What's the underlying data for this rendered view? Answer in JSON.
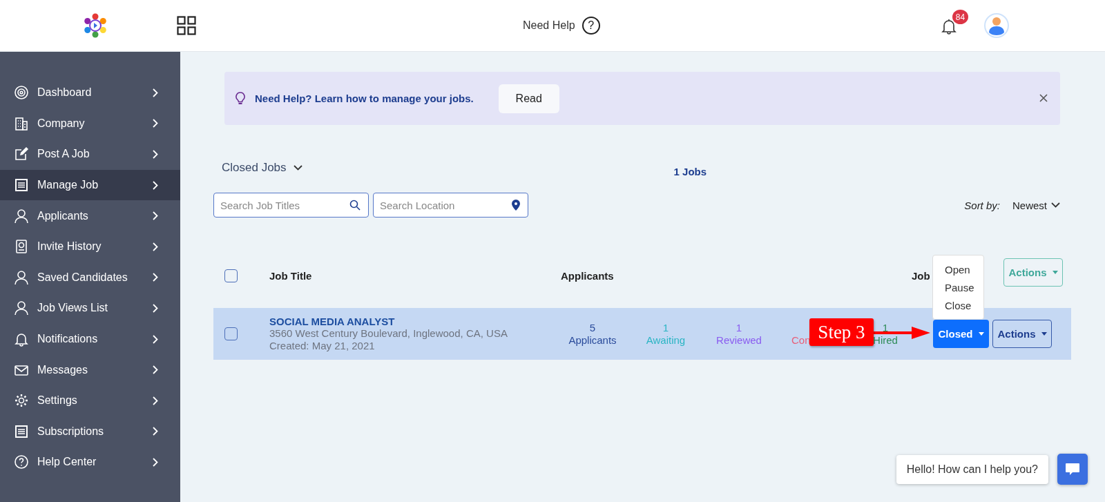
{
  "header": {
    "help_label": "Need Help",
    "help_glyph": "?",
    "notification_count": "84"
  },
  "sidebar": {
    "items": [
      {
        "label": "Dashboard",
        "kind": "target",
        "selected": false
      },
      {
        "label": "Company",
        "kind": "building",
        "selected": false
      },
      {
        "label": "Post A Job",
        "kind": "edit",
        "selected": false
      },
      {
        "label": "Manage Job",
        "kind": "list",
        "selected": true
      },
      {
        "label": "Applicants",
        "kind": "user",
        "selected": false
      },
      {
        "label": "Invite History",
        "kind": "invite",
        "selected": false
      },
      {
        "label": "Saved Candidates",
        "kind": "user",
        "selected": false
      },
      {
        "label": "Job Views List",
        "kind": "user",
        "selected": false
      },
      {
        "label": "Notifications",
        "kind": "bell",
        "selected": false
      },
      {
        "label": "Messages",
        "kind": "mail",
        "selected": false
      },
      {
        "label": "Settings",
        "kind": "gear",
        "selected": false
      },
      {
        "label": "Subscriptions",
        "kind": "list",
        "selected": false
      },
      {
        "label": "Help Center",
        "kind": "help",
        "selected": false
      }
    ]
  },
  "banner": {
    "text": "Need Help? Learn how to manage your jobs.",
    "button": "Read"
  },
  "filter": {
    "value": "Closed Jobs",
    "count": "1 Jobs"
  },
  "search": {
    "title_placeholder": "Search Job Titles",
    "location_placeholder": "Search Location"
  },
  "sort": {
    "label": "Sort by:",
    "value": "Newest"
  },
  "table": {
    "columns": [
      "Job Title",
      "Applicants",
      "Job"
    ],
    "actions_button": "Actions",
    "header_checked": false,
    "rows": [
      {
        "checked": false,
        "title": "SOCIAL MEDIA ANALYST",
        "address": "3560 West Century Boulevard, Inglewood, CA, USA",
        "created": "Created: May 21, 2021",
        "stats": [
          {
            "value": "5",
            "label": "Applicants",
            "color": "#2a4b9b"
          },
          {
            "value": "1",
            "label": "Awaiting",
            "color": "#2bb5c4"
          },
          {
            "value": "1",
            "label": "Reviewed",
            "color": "#8a5cf0"
          },
          {
            "label": "Con",
            "color": "#e8607a"
          },
          {
            "value": "1",
            "label": "Hired",
            "color": "#2e8b57"
          }
        ],
        "status": "Closed",
        "actions": "Actions"
      }
    ]
  },
  "status_menu": {
    "items": [
      "Open",
      "Pause",
      "Close"
    ]
  },
  "annotation": {
    "label": "Step 3"
  },
  "chat": {
    "greeting": "Hello! How can I help you?"
  }
}
